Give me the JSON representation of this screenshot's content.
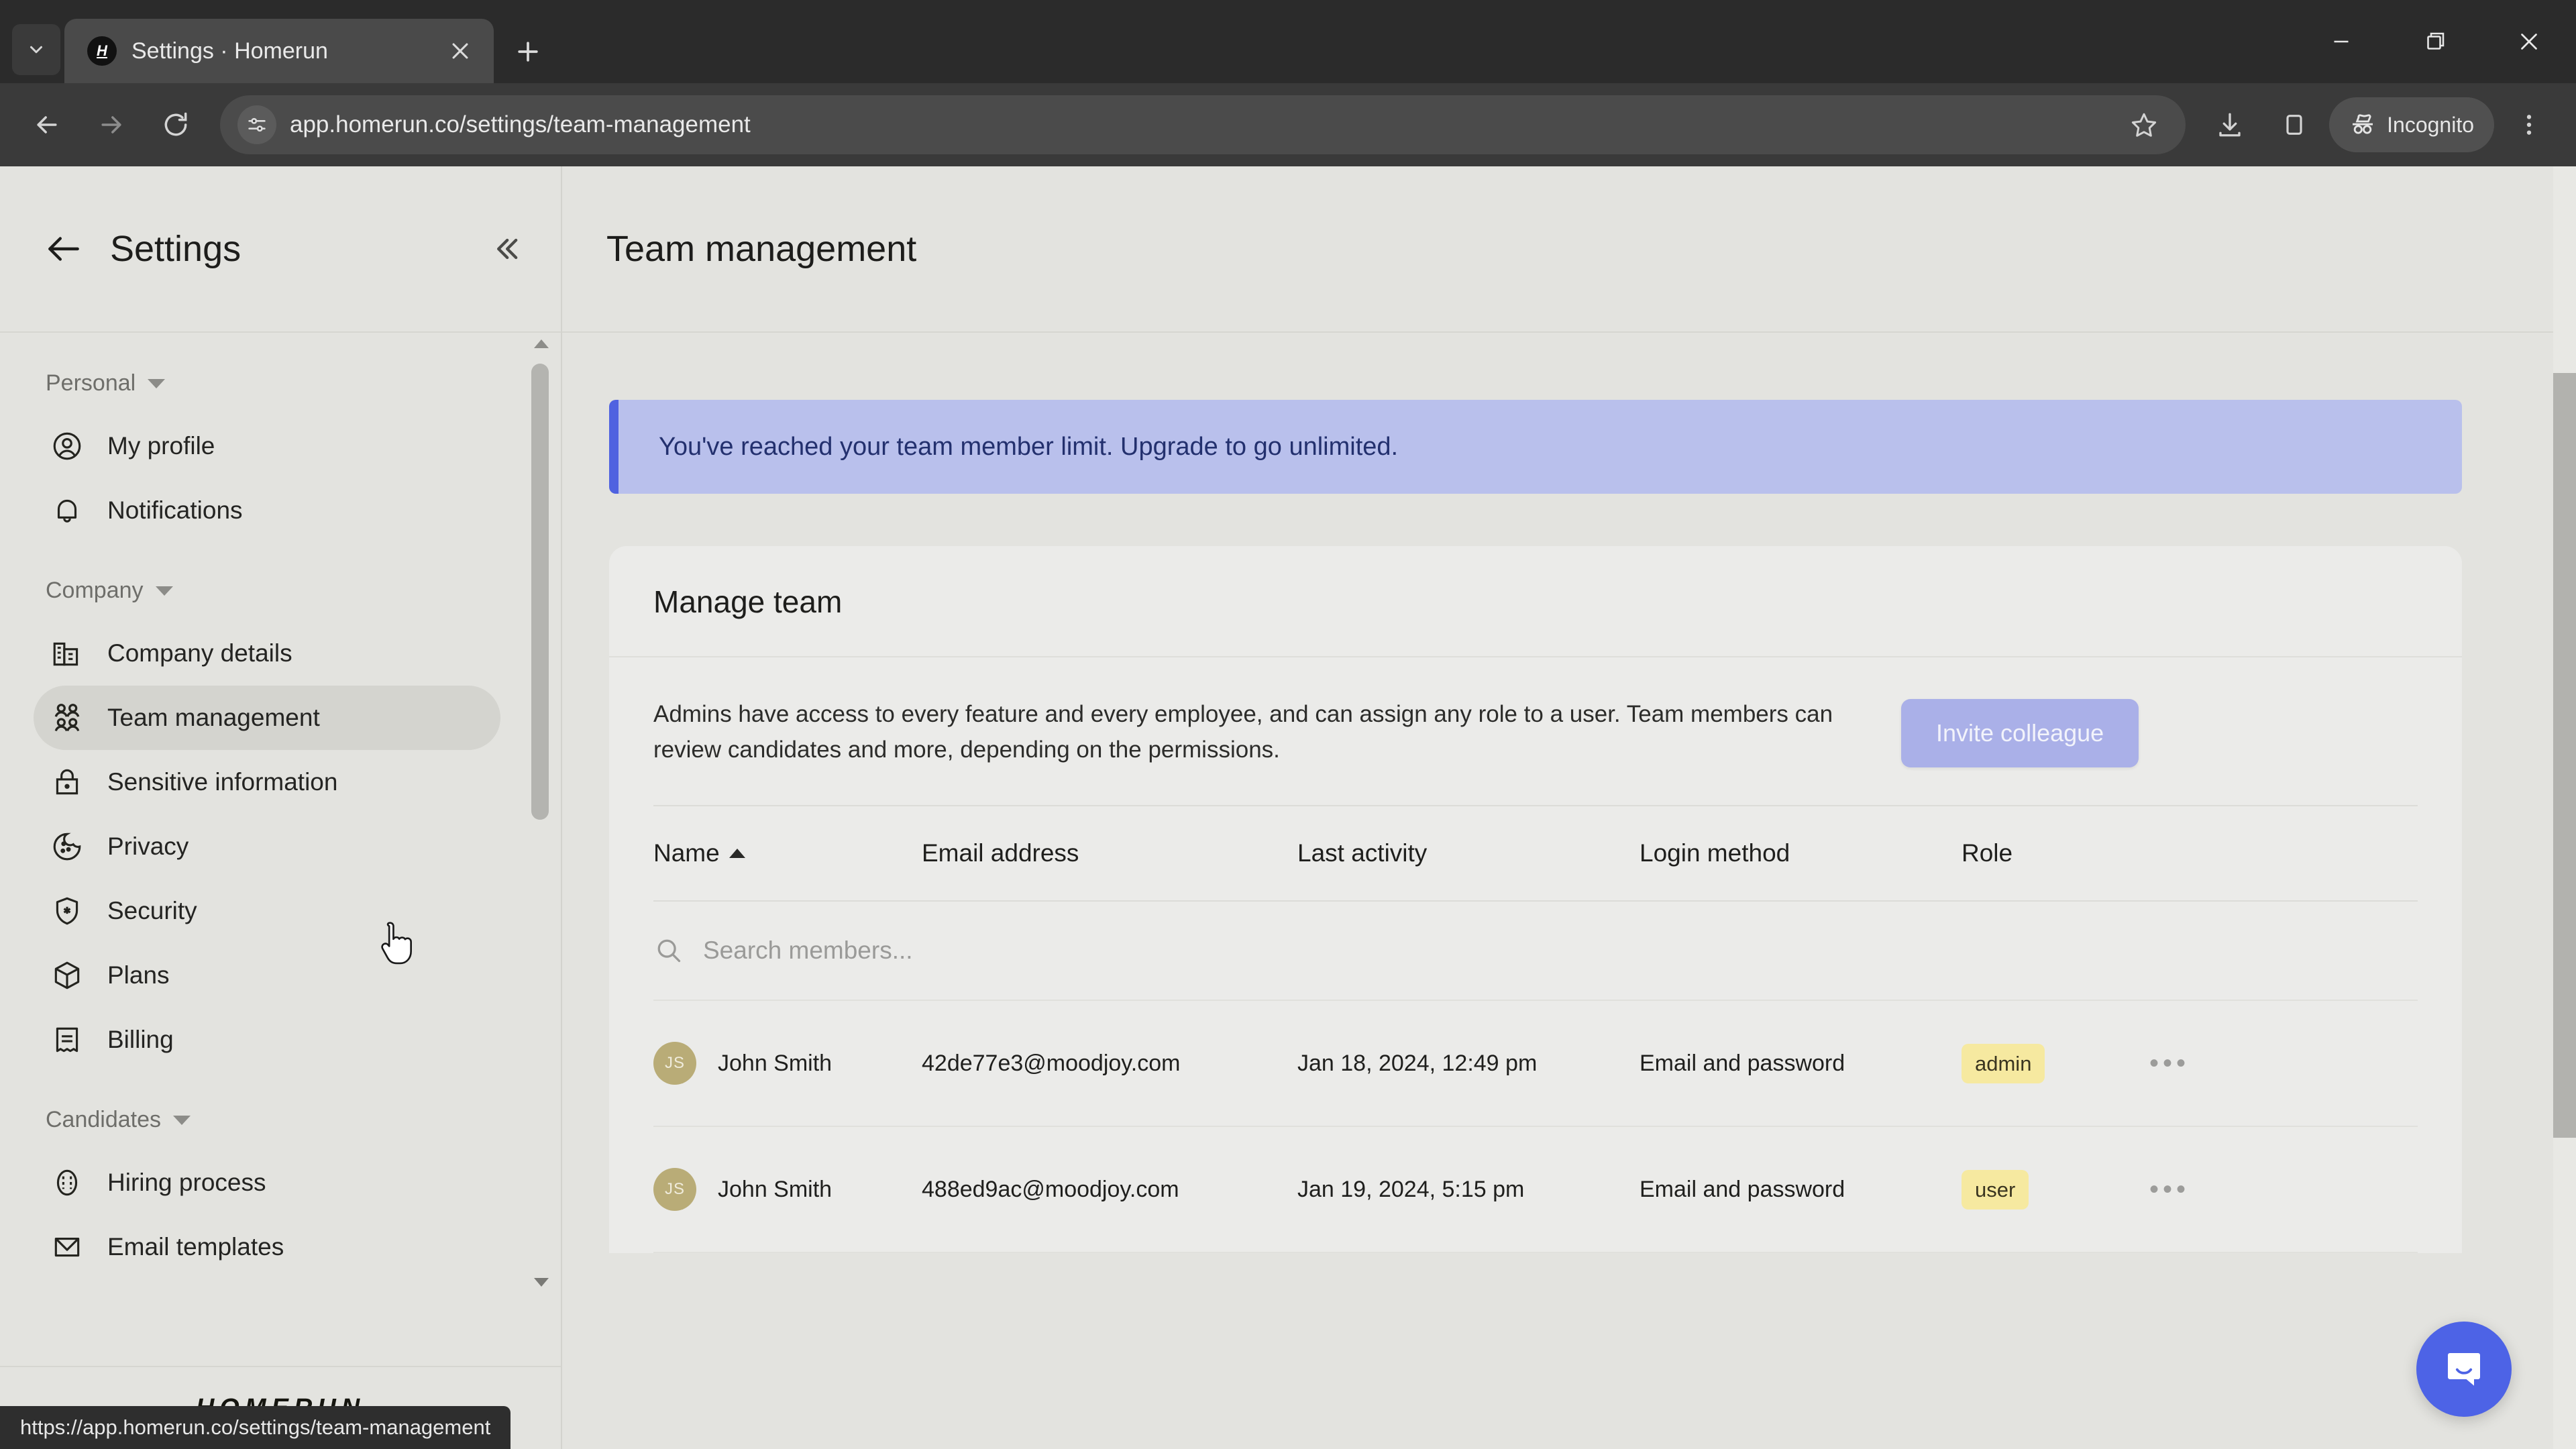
{
  "browser": {
    "tab": {
      "title": "Settings · Homerun",
      "favicon_letter": "H"
    },
    "new_tab_label": "+",
    "close_tab_label": "✕",
    "tab_search_label": "⌄",
    "window": {
      "minimize": "—",
      "maximize": "❐",
      "close": "✕"
    },
    "toolbar": {
      "back": "←",
      "forward": "→",
      "reload": "⟳",
      "url": "app.homerun.co/settings/team-management",
      "bookmark": "☆",
      "downloads": "download-icon",
      "sidepanel": "panel-icon",
      "profile_label": "Incognito",
      "menu": "⋮"
    },
    "status_bar_url": "https://app.homerun.co/settings/team-management"
  },
  "sidebar": {
    "title": "Settings",
    "back_label": "←",
    "collapse_label": "«",
    "groups": [
      {
        "label": "Personal",
        "items": [
          {
            "label": "My profile",
            "icon": "user-circle-icon"
          },
          {
            "label": "Notifications",
            "icon": "bell-icon"
          }
        ]
      },
      {
        "label": "Company",
        "items": [
          {
            "label": "Company details",
            "icon": "building-icon"
          },
          {
            "label": "Team management",
            "icon": "people-icon",
            "active": true
          },
          {
            "label": "Sensitive information",
            "icon": "lock-icon"
          },
          {
            "label": "Privacy",
            "icon": "cookie-icon"
          },
          {
            "label": "Security",
            "icon": "shield-icon"
          },
          {
            "label": "Plans",
            "icon": "box-icon"
          },
          {
            "label": "Billing",
            "icon": "receipt-icon"
          }
        ]
      },
      {
        "label": "Candidates",
        "items": [
          {
            "label": "Hiring process",
            "icon": "pipeline-icon"
          },
          {
            "label": "Email templates",
            "icon": "envelope-icon"
          }
        ]
      }
    ],
    "brand": "HOMERUN"
  },
  "main": {
    "page_title": "Team management",
    "banner": {
      "text": "You've reached your team member limit. Upgrade to go unlimited.",
      "accent_color": "#4f62e0",
      "background_color": "#b9c0ec"
    },
    "card": {
      "title": "Manage team",
      "description": "Admins have access to every feature and every employee, and can assign any role to a user. Team members can review candidates and more, depending on the permissions.",
      "invite_button": "Invite colleague",
      "invite_button_color": "#aab0e8"
    },
    "table": {
      "columns": [
        "Name",
        "Email address",
        "Last activity",
        "Login method",
        "Role"
      ],
      "sort_column": "Name",
      "sort_direction": "asc",
      "search_placeholder": "Search members...",
      "search_value": "",
      "rows": [
        {
          "initials": "JS",
          "name": "John Smith",
          "email": "42de77e3@moodjoy.com",
          "last_activity": "Jan 18, 2024, 12:49 pm",
          "login_method": "Email and password",
          "role": "admin",
          "more": "•••"
        },
        {
          "initials": "JS",
          "name": "John Smith",
          "email": "488ed9ac@moodjoy.com",
          "last_activity": "Jan 19, 2024, 5:15 pm",
          "login_method": "Email and password",
          "role": "user",
          "more": "•••"
        }
      ]
    },
    "chat_launcher": "chat-bubble-icon"
  }
}
